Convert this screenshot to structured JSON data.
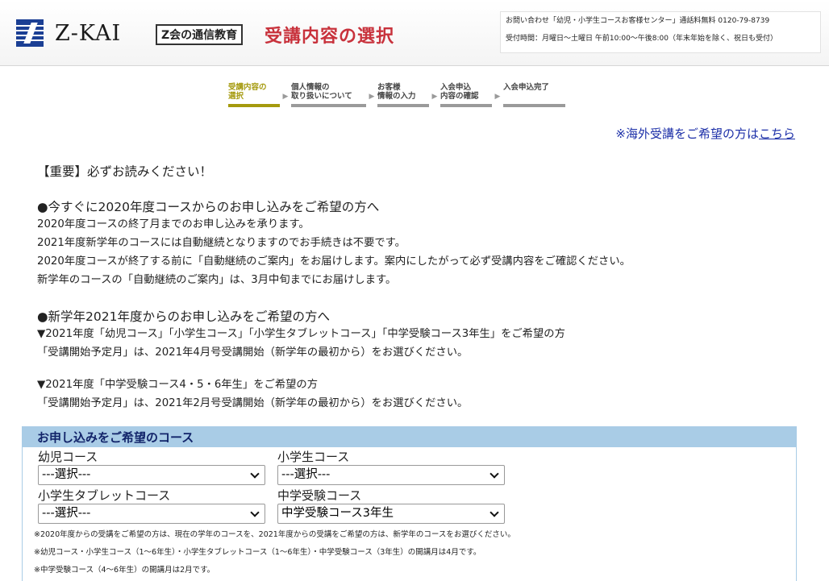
{
  "header": {
    "logo_text": "Z-KAI",
    "service_badge": "Z会の通信教育",
    "page_heading": "受講内容の選択",
    "contact_line1": "お問い合わせ「幼児・小学生コースお客様センター」通話料無料 0120-79-8739",
    "contact_line2": "受付時間：月曜日～土曜日 午前10:00～午後8:00（年末年始を除く、祝日も受付）"
  },
  "steps": [
    {
      "line1": "受講内容の",
      "line2": "選択",
      "active": true
    },
    {
      "line1": "個人情報の",
      "line2": "取り扱いについて",
      "active": false
    },
    {
      "line1": "お客様",
      "line2": "情報の入力",
      "active": false
    },
    {
      "line1": "入会申込",
      "line2": "内容の確認",
      "active": false
    },
    {
      "line1": "入会申込完了",
      "line2": "",
      "active": false
    }
  ],
  "overseas": {
    "prefix": "※海外受講をご希望の方は",
    "link": "こちら"
  },
  "content": {
    "important": "【重要】必ずお読みください！",
    "section1": {
      "heading": "●今すぐに2020年度コースからのお申し込みをご希望の方へ",
      "lines": [
        "2020年度コースの終了月までのお申し込みを承ります。",
        "2021年度新学年のコースには自動継続となりますのでお手続きは不要です。",
        "2020年度コースが終了する前に「自動継続のご案内」をお届けします。案内にしたがって必ず受講内容をご確認ください。",
        "新学年のコースの「自動継続のご案内」は、3月中旬までにお届けします。"
      ]
    },
    "section2": {
      "heading": "●新学年2021年度からのお申し込みをご希望の方へ",
      "lines_a": [
        "▼2021年度「幼児コース」「小学生コース」「小学生タブレットコース」「中学受験コース3年生」をご希望の方",
        "「受講開始予定月」は、2021年4月号受講開始（新学年の最初から）をお選びください。"
      ],
      "lines_b": [
        "▼2021年度「中学受験コース4・5・6年生」をご希望の方",
        "「受講開始予定月」は、2021年2月号受講開始（新学年の最初から）をお選びください。"
      ]
    }
  },
  "courses": {
    "heading": "お申し込みをご希望のコース",
    "fields": [
      {
        "label": "幼児コース",
        "value": "---選択---"
      },
      {
        "label": "小学生コース",
        "value": "---選択---"
      },
      {
        "label": "小学生タブレットコース",
        "value": "---選択---"
      },
      {
        "label": "中学受験コース",
        "value": "中学受験コース3年生"
      }
    ],
    "notes": [
      "※2020年度からの受講をご希望の方は、現在の学年のコースを、2021年度からの受講をご希望の方は、新学年のコースをお選びください。",
      "※幼児コース・小学生コース（1～6年生）・小学生タブレットコース（1～6年生）・中学受験コース（3年生）の開講月は4月です。",
      "※中学受験コース（4～6年生）の開講月は2月です。"
    ]
  }
}
